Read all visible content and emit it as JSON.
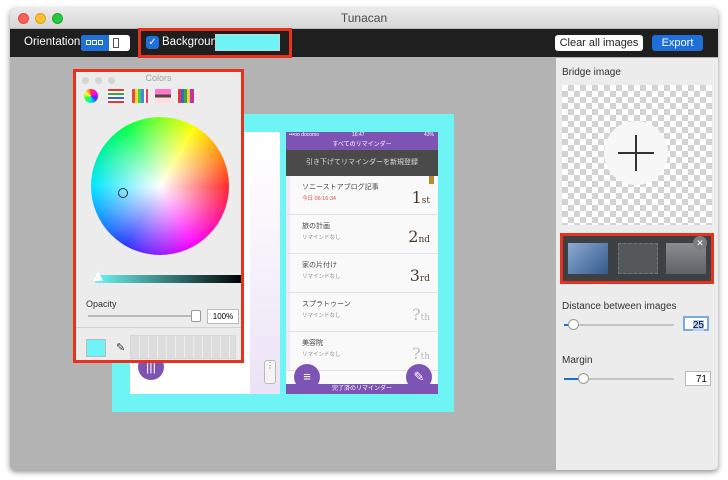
{
  "window": {
    "title": "Tunacan"
  },
  "toolbar": {
    "orientation_label": "Orientation",
    "background_label": "Background",
    "background_checked": true,
    "background_color": "#6ef4f4",
    "clear_label": "Clear all images",
    "export_label": "Export"
  },
  "colors_panel": {
    "title": "Colors",
    "tabs": [
      "color-wheel-icon",
      "color-sliders-icon",
      "color-palettes-icon",
      "image-palettes-icon",
      "crayons-icon"
    ],
    "opacity_label": "Opacity",
    "opacity_value": "100%",
    "current_color": "#6ef4f4"
  },
  "preview": {
    "status_left": "•••oo docomo",
    "status_time": "16:47",
    "status_right": "43%",
    "header": "すべてのリマインダー",
    "pull_hint": "引き下げてリマインダーを新規登録",
    "reminders": [
      {
        "title": "ソニーストアブログ記事",
        "sub": "今日 06:16:34",
        "rank": "1",
        "suffix": "st"
      },
      {
        "title": "旅の計画",
        "sub": "リマインドなし",
        "rank": "2",
        "suffix": "nd"
      },
      {
        "title": "家の片付け",
        "sub": "リマインドなし",
        "rank": "3",
        "suffix": "rd"
      },
      {
        "title": "スプラトゥーン",
        "sub": "リマインドなし",
        "rank": "?",
        "suffix": "th"
      },
      {
        "title": "美容院",
        "sub": "リマインドなし",
        "rank": "?",
        "suffix": "th"
      }
    ],
    "footer": "完了済のリマインダー"
  },
  "sidebar": {
    "bridge_label": "Bridge image",
    "distance_label": "Distance between images",
    "distance_value": "25",
    "margin_label": "Margin",
    "margin_value": "71"
  }
}
